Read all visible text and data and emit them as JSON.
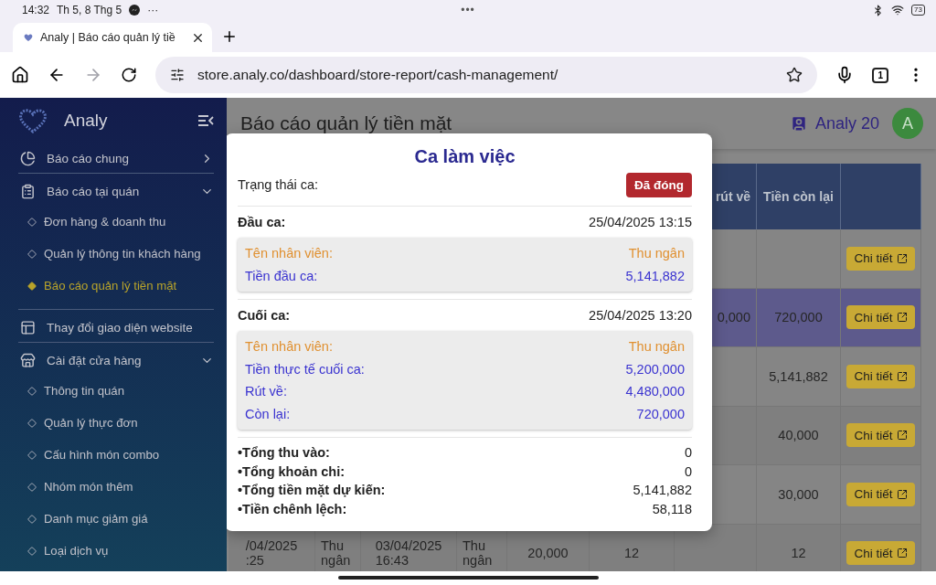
{
  "status_bar": {
    "time": "14:32",
    "date": "Th 5, 8 Thg 5",
    "more": "···",
    "center": "•••",
    "battery": "73"
  },
  "browser": {
    "tab": {
      "title": "Analy | Báo cáo quản lý tiề",
      "selected": true
    },
    "url": "store.analy.co/dashboard/store-report/cash-management/",
    "tab_count": "1",
    "forward_disabled": true
  },
  "sidebar": {
    "brand": "Analy",
    "items": [
      {
        "label": "Báo cáo chung",
        "kind": "pie",
        "expanded": false
      },
      {
        "label": "Báo cáo tại quán",
        "kind": "clipboard",
        "expanded": true,
        "children": [
          {
            "label": "Đơn hàng & doanh thu",
            "selected": false
          },
          {
            "label": "Quản lý thông tin khách hàng",
            "selected": false
          },
          {
            "label": "Báo cáo quản lý tiền mặt",
            "selected": true
          }
        ]
      },
      {
        "label": "Thay đổi giao diện website",
        "kind": "layout"
      },
      {
        "label": "Cài đặt cửa hàng",
        "kind": "store",
        "expanded": true,
        "children": [
          {
            "label": "Thông tin quán",
            "selected": false
          },
          {
            "label": "Quản lý thực đơn",
            "selected": false
          },
          {
            "label": "Cấu hình món combo",
            "selected": false
          },
          {
            "label": "Nhóm món thêm",
            "selected": false
          },
          {
            "label": "Danh mục giảm giá",
            "selected": false
          },
          {
            "label": "Loại dịch vụ",
            "selected": false
          }
        ]
      }
    ]
  },
  "header": {
    "title": "Báo cáo quản lý tiền mặt",
    "user": "Analy 20",
    "avatar": "A"
  },
  "table": {
    "columns": {
      "column_7": "rút về",
      "column_8": "Tiền còn lại"
    },
    "rows": [
      {
        "selected": false,
        "action": "Chi tiết"
      },
      {
        "selected": true,
        "column_7": "0,000",
        "column_8": "720,000",
        "action": "Chi tiết"
      },
      {
        "selected": false,
        "column_8": "5,141,882",
        "action": "Chi tiết"
      },
      {
        "selected": false,
        "column_8": "40,000",
        "action": "Chi tiết"
      },
      {
        "selected": false,
        "column_8": "30,000",
        "action": "Chi tiết"
      },
      {
        "selected": false,
        "column_1": "/04/2025\n:25",
        "column_2": "Thu ngân",
        "column_3": "03/04/2025\n16:43",
        "column_4": "Thu ngân",
        "column_5": "20,000",
        "column_6": "12",
        "column_8": "12",
        "action": "Chi tiết"
      }
    ]
  },
  "modal": {
    "title": "Ca làm việc",
    "status": {
      "label": "Trạng thái ca:",
      "value": "Đã đóng",
      "kind": "closed"
    },
    "sections": [
      {
        "label": "Đầu ca:",
        "time": "25/04/2025 13:15",
        "details": [
          {
            "label": "Tên nhân viên:",
            "value": "Thu ngân",
            "kind": "staff"
          },
          {
            "label": "Tiền đầu ca:",
            "value": "5,141,882",
            "kind": "amount"
          }
        ]
      },
      {
        "label": "Cuối ca:",
        "time": "25/04/2025 13:20",
        "details": [
          {
            "label": "Tên nhân viên:",
            "value": "Thu ngân",
            "kind": "staff"
          },
          {
            "label": "Tiền thực tế cuối ca:",
            "value": "5,200,000",
            "kind": "amount"
          },
          {
            "label": "Rút về:",
            "value": "4,480,000",
            "kind": "amount"
          },
          {
            "label": "Còn lại:",
            "value": "720,000",
            "kind": "amount"
          }
        ]
      }
    ],
    "summary": [
      {
        "label": "•Tổng thu vào:",
        "value": "0"
      },
      {
        "label": "•Tổng khoản chi:",
        "value": "0"
      },
      {
        "label": "•Tổng tiền mặt dự kiến:",
        "value": "5,141,882"
      },
      {
        "label": "•Tiền chênh lệch:",
        "value": "58,118"
      }
    ]
  }
}
